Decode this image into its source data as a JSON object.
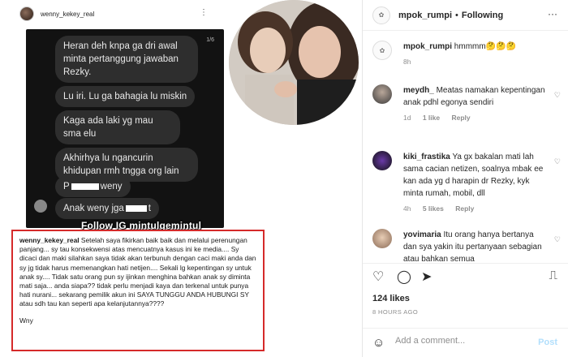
{
  "story": {
    "username": "wenny_kekey_real",
    "menu": "⋮",
    "pager": "1/6",
    "bubbles": [
      "Heran deh knpa ga dri awal minta pertanggung jawaban Rezky.",
      "Lu iri. Lu ga bahagia lu miskin",
      "Kaga ada laki yg mau sma elu",
      "Akhirhya lu ngancurin khidupan rmh tngga org lain",
      "P",
      "weny",
      "Anak weny jga",
      "t"
    ],
    "watermark": "Follow IG mintulgemintul"
  },
  "caption": {
    "username": "wenny_kekey_real",
    "text": "Setelah saya fikirkan baik baik dan melalui perenungan panjang... sy tau konsekwensi atas mencuatnya kasus ini ke media.... Sy dicaci dan maki silahkan saya tidak akan terbunuh dengan caci maki anda dan sy jg tidak harus memenangkan hati netijen.... Sekali lg kepentingan sy untuk anak sy.... Tidak satu orang pun sy ijinkan menghina bahkan anak sy diminta mati saja... anda siapa?? tidak perlu menjadi kaya dan terkenal untuk punya hati nurani... sekarang pemilik akun ini SAYA TUNGGU ANDA HUBUNGI SY atau sdh tau kan seperti apa kelanjutannya????",
    "signature": "Wny"
  },
  "panel": {
    "account": "mpok_rumpi",
    "separator": "•",
    "follow_status": "Following",
    "more": "···",
    "post_caption": {
      "user": "mpok_rumpi",
      "text": "hmmmm🤔🤔🤔",
      "time": "8h"
    },
    "comments": [
      {
        "user": "meydh_",
        "text": "Meatas namakan kepentingan anak pdhl egonya sendiri",
        "time": "1d",
        "likes": "1 like",
        "reply": "Reply"
      },
      {
        "user": "kiki_frastika",
        "text": "Ya gx bakalan mati lah sama cacian netizen, soalnya mbak ee kan ada yg d harapin dr Rezky, kyk minta rumah, mobil, dll",
        "time": "4h",
        "likes": "5 likes",
        "reply": "Reply"
      },
      {
        "user": "yovimaria",
        "text": "Itu orang hanya bertanya dan sya yakin itu pertanyaan sebagian atau bahkan semua",
        "time": "",
        "likes": "",
        "reply": ""
      }
    ],
    "likes_count": "124 likes",
    "posted_ago": "8 HOURS AGO",
    "comment_placeholder": "Add a comment...",
    "post_label": "Post"
  },
  "colors": {
    "highlight_border": "#d52a2a",
    "chat_bg": "#121212",
    "bubble_bg": "#2e2e2e",
    "post_disabled": "#b2dffc"
  }
}
